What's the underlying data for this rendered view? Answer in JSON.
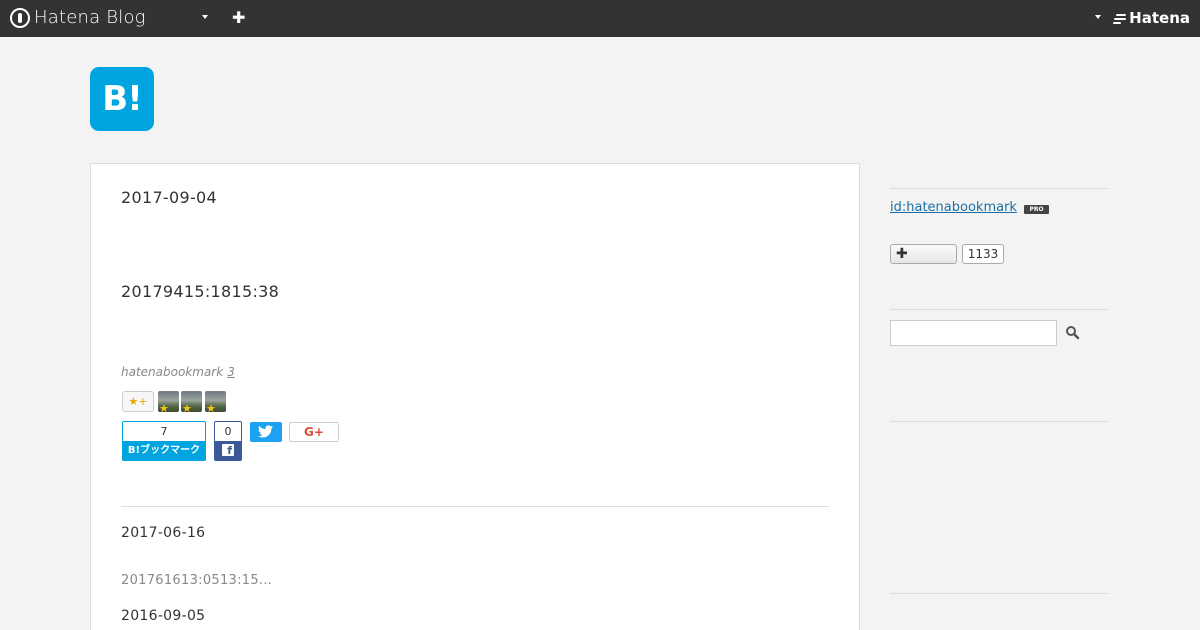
{
  "topbar": {
    "logo_text": "Hatena Blog",
    "brand_text": "Hatena",
    "add_symbol": "✚"
  },
  "blog": {
    "icon_text": "B!"
  },
  "main": {
    "entry": {
      "date": "2017-09-04",
      "title": "20179415:1815:38",
      "author": "hatenabookmark",
      "comment_count": "3",
      "star_add_label": "★+",
      "star_avatar_count": 3
    },
    "share": {
      "hatena_count": "7",
      "hatena_label": "B!ブックマーク",
      "facebook_count": "0",
      "facebook_label": "f",
      "googleplus_label": "G+"
    },
    "list": [
      {
        "date": "2017-06-16",
        "excerpt": "201761613:0513:15..."
      },
      {
        "date": "2016-09-05"
      }
    ]
  },
  "sidebar": {
    "profile_id": "id:hatenabookmark",
    "pro_badge": "PRO",
    "subscribe_symbol": "✚",
    "subscriber_count": "1133",
    "search_placeholder": ""
  },
  "colors": {
    "topbar_bg": "#333333",
    "hatena_blue": "#00a4de",
    "facebook": "#3b5998",
    "twitter": "#1da1f2",
    "googleplus": "#dd4b39",
    "page_bg": "#f3f3f3"
  }
}
